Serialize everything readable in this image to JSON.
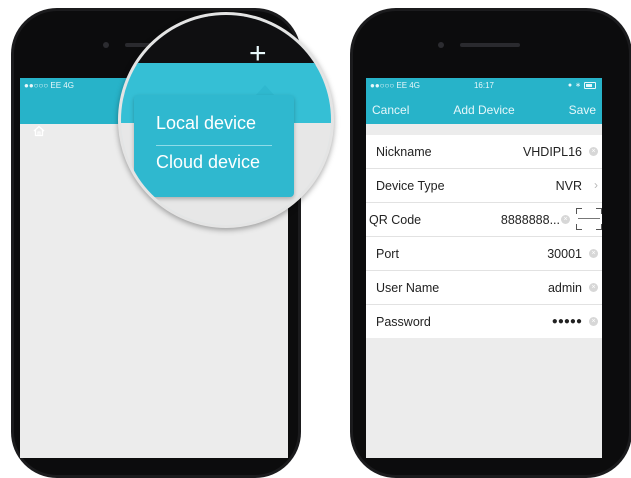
{
  "left_phone": {
    "status": {
      "carrier": "●●○○○ EE  4G"
    },
    "icons": {
      "home": "home-icon",
      "add": "plus-icon"
    },
    "popup": {
      "plus_symbol": "+",
      "items": [
        "Local device",
        "Cloud device"
      ]
    }
  },
  "right_phone": {
    "status": {
      "carrier": "●●○○○ EE  4G",
      "time": "16:17"
    },
    "nav": {
      "cancel": "Cancel",
      "title": "Add Device",
      "save": "Save"
    },
    "form": {
      "nickname": {
        "label": "Nickname",
        "value": "VHDIPL16"
      },
      "device_type": {
        "label": "Device Type",
        "value": "NVR"
      },
      "qr_code": {
        "label": "QR Code",
        "value": "8888888..."
      },
      "port": {
        "label": "Port",
        "value": "30001"
      },
      "user_name": {
        "label": "User Name",
        "value": "admin"
      },
      "password": {
        "label": "Password",
        "value": "●●●●●"
      }
    }
  },
  "colors": {
    "accent": "#27b3c9",
    "popup": "#2fb8cf",
    "frame": "#1b1b1d"
  }
}
